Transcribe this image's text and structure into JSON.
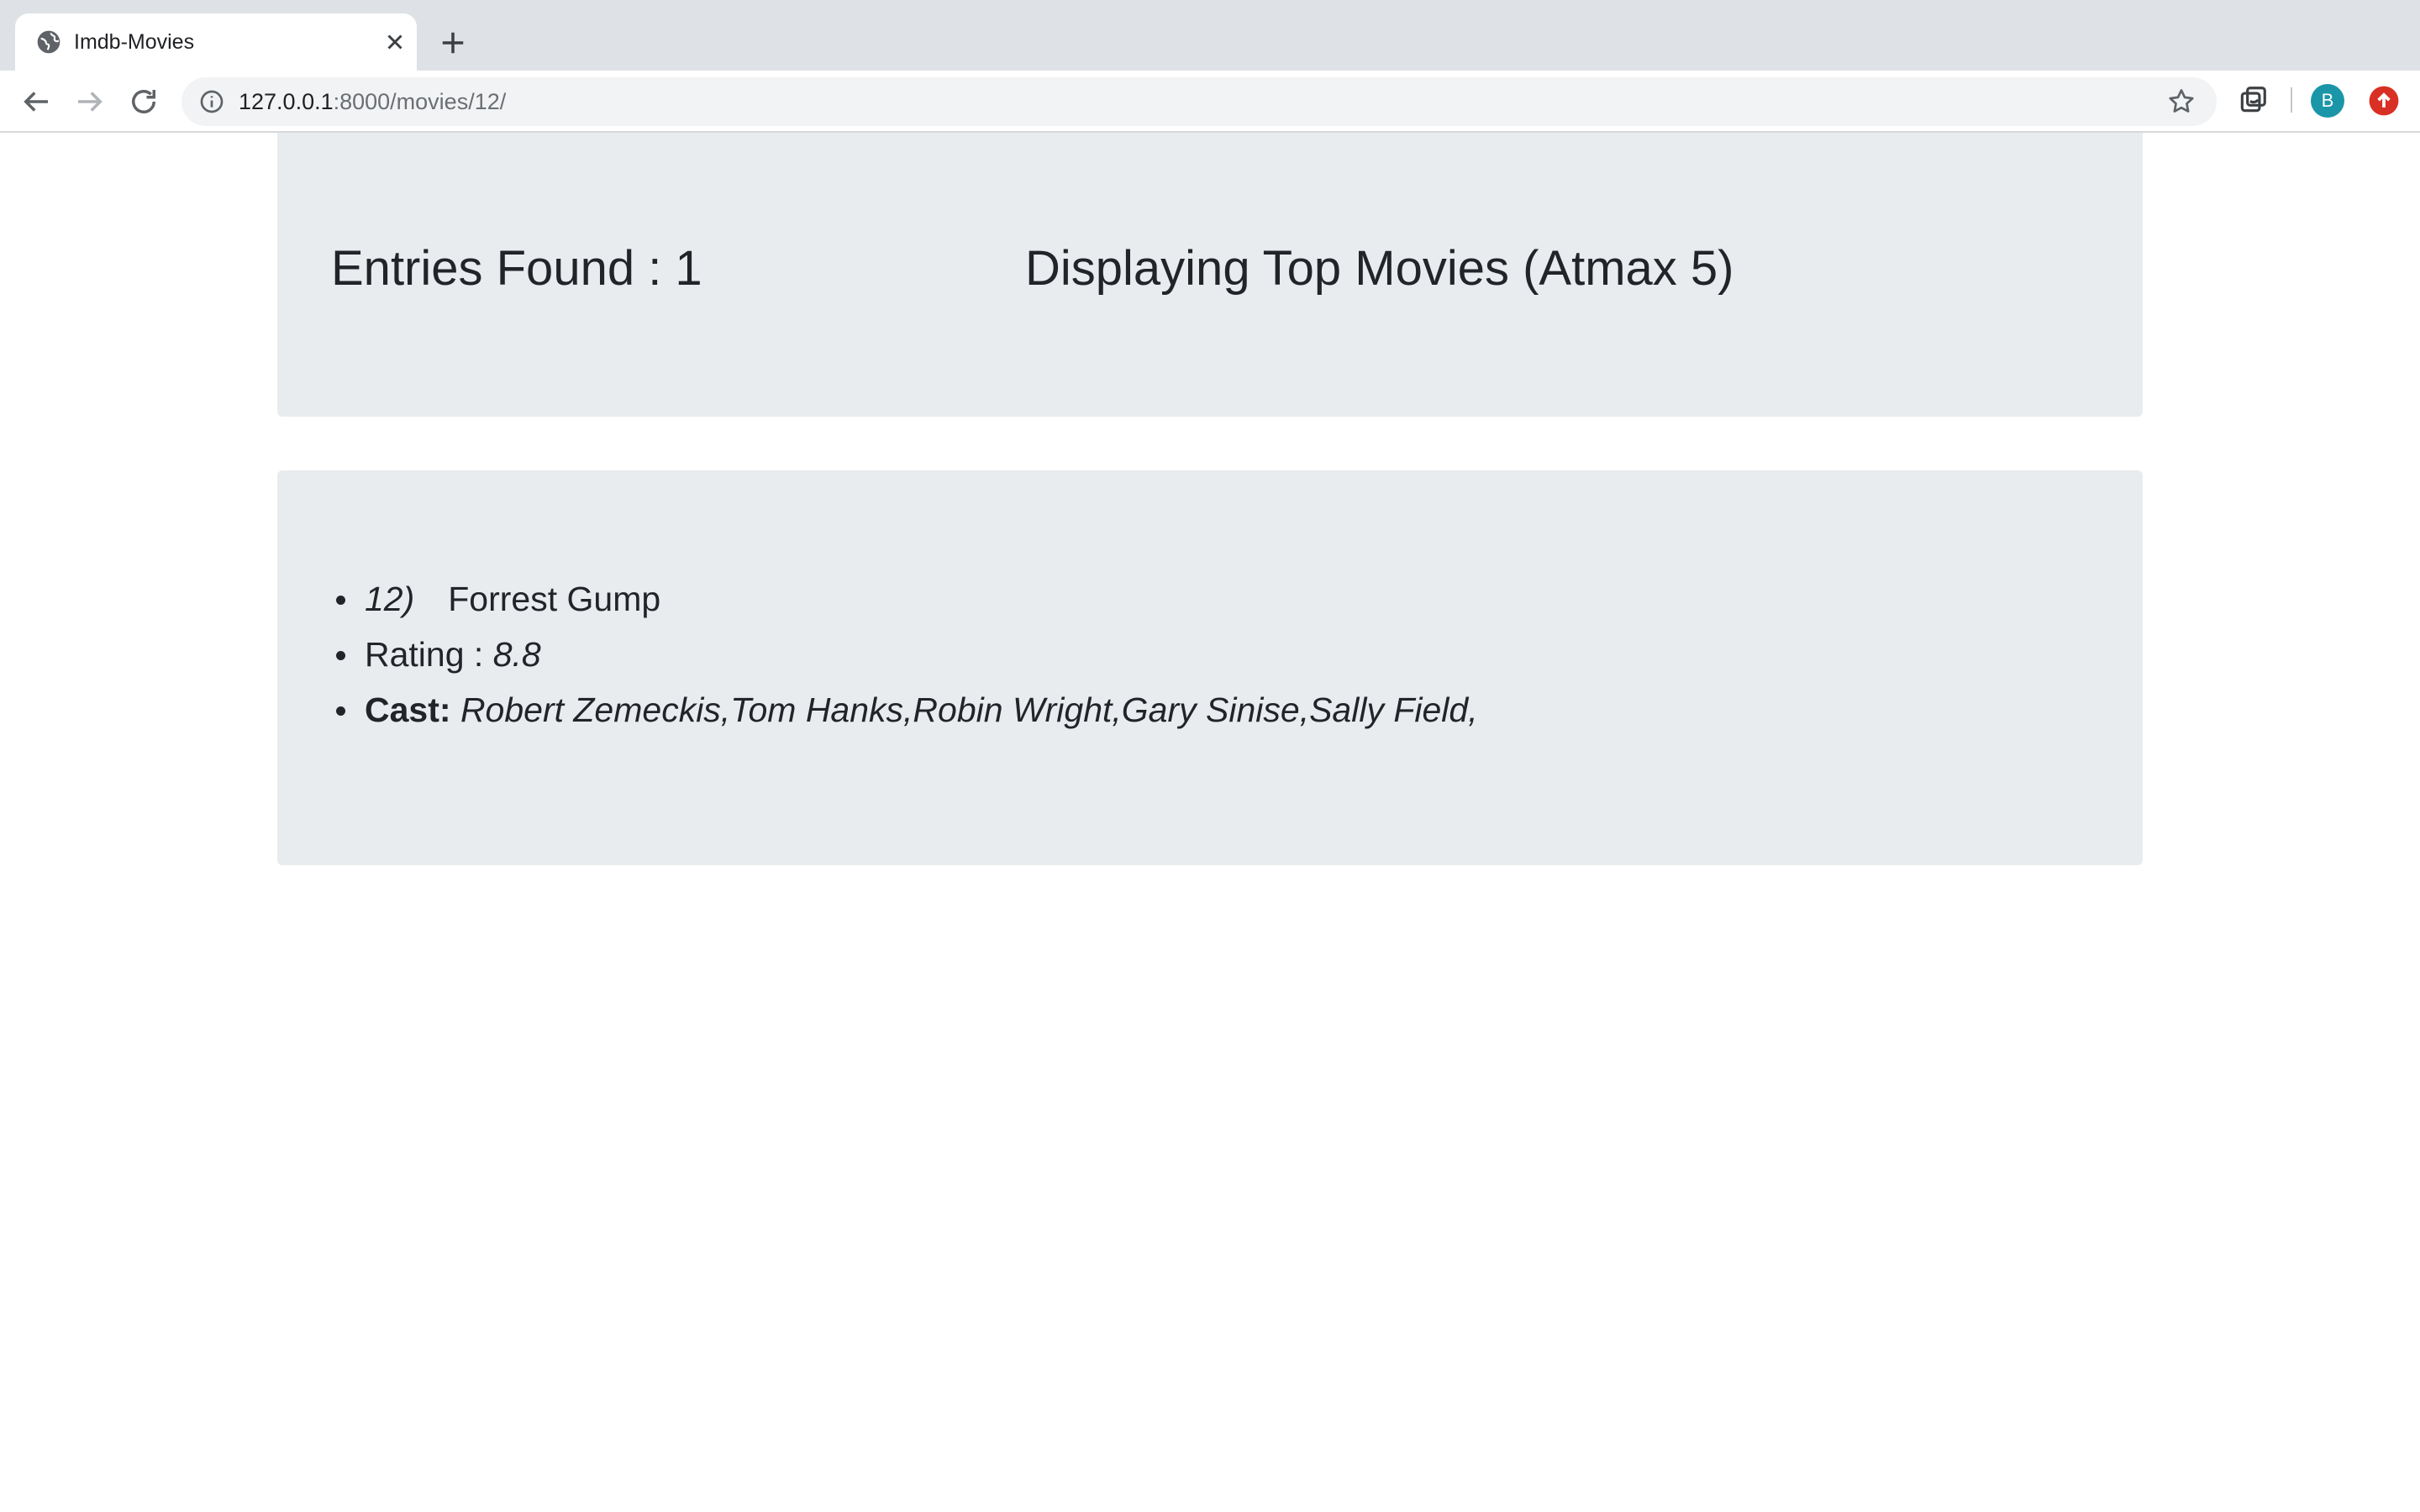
{
  "browser": {
    "tab_title": "Imdb-Movies",
    "url_host": "127.0.0.1",
    "url_rest": ":8000/movies/12/",
    "profile_initial": "B"
  },
  "summary": {
    "entries_found": "Entries Found : 1",
    "displaying": "Displaying Top Movies (Atmax 5)"
  },
  "movie": {
    "number": "12)",
    "title": "Forrest Gump",
    "rating_label": "Rating :",
    "rating_value": "8.8",
    "cast_label": "Cast:",
    "cast_value": "Robert Zemeckis,Tom Hanks,Robin Wright,Gary Sinise,Sally Field,"
  },
  "colors": {
    "jumbotron": "#e9ecef",
    "text": "#212529",
    "avatar": "#1a96a8",
    "update_badge": "#d93025"
  }
}
